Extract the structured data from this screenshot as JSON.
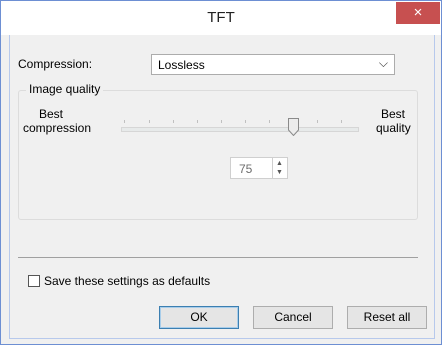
{
  "window": {
    "title": "TFT",
    "close_symbol": "×"
  },
  "compression": {
    "label": "Compression:",
    "selected": "Lossless",
    "arrow": "⌵"
  },
  "image_quality": {
    "group_label": "Image quality",
    "left_label_line1": "Best",
    "left_label_line2": "compression",
    "right_label_line1": "Best",
    "right_label_line2": "quality",
    "value": "75",
    "slider_fraction": 0.75
  },
  "save_defaults": {
    "label": "Save these settings as defaults",
    "checked": false
  },
  "buttons": {
    "ok": "OK",
    "cancel": "Cancel",
    "reset": "Reset all"
  },
  "colors": {
    "close_button": "#c75050",
    "default_button_border": "#3c7fb1"
  }
}
